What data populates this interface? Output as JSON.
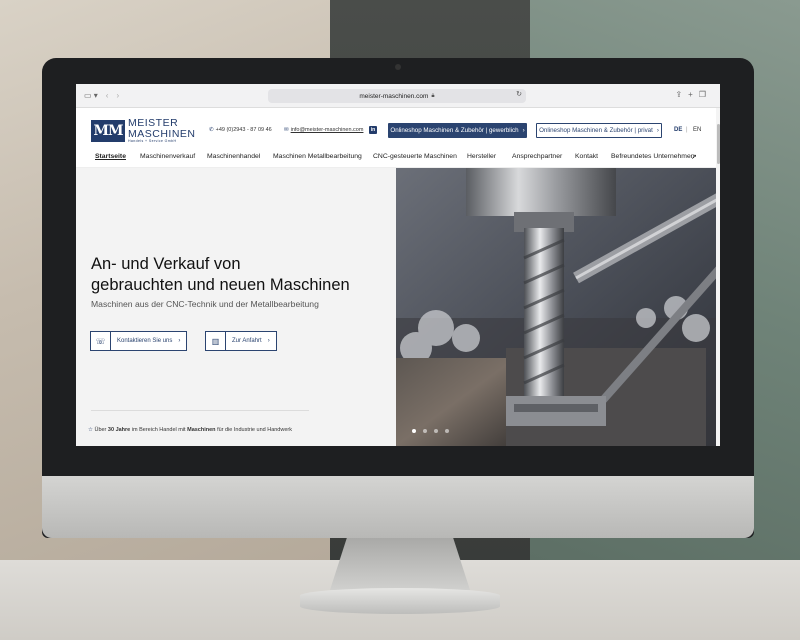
{
  "browser": {
    "url": "meister-maschinen.com",
    "sidebar_icon": "sidebar-icon",
    "back_icon": "chevron-left-icon",
    "forward_icon": "chevron-right-icon",
    "share_icon": "share-icon",
    "new_tab_icon": "plus-icon",
    "tabs_icon": "tabs-icon"
  },
  "header": {
    "logo_mark": "MM",
    "logo_title": "MEISTER",
    "logo_title2": "MASCHINEN",
    "logo_subtitle": "Handels + Service GmbH",
    "phone": "+49 (0)2943 - 87 09 46",
    "email": "info@meister-maschinen.com",
    "linkedin": "in",
    "shop_business": "Onlineshop Maschinen & Zubehör | gewerblich",
    "shop_private": "Onlineshop Maschinen & Zubehör | privat",
    "lang_de": "DE",
    "lang_sep": "|",
    "lang_en": "EN"
  },
  "nav": {
    "items": [
      "Startseite",
      "Maschinenverkauf",
      "Maschinenhandel",
      "Maschinen Metallbearbeitung",
      "CNC-gesteuerte Maschinen",
      "Hersteller",
      "Ansprechpartner",
      "Kontakt",
      "Befreundetes Unternehmen"
    ],
    "active_index": 0
  },
  "hero": {
    "title_line1": "An- und Verkauf von",
    "title_line2": "gebrauchten und neuen Maschinen",
    "subtitle": "Maschinen aus der CNC-Technik und der Metallbearbeitung",
    "cta_contact": "Kontaktieren Sie uns",
    "cta_route": "Zur Anfahrt",
    "note_prefix": "Über",
    "note_years": "30 Jahre",
    "note_middle": "im Bereich Handel mit",
    "note_machines": "Maschinen",
    "note_suffix": "für die Industrie und Handwerk",
    "slides_total": 4,
    "slide_active": 1
  },
  "colors": {
    "brand": "#233c6b",
    "button": "#2b4470"
  }
}
